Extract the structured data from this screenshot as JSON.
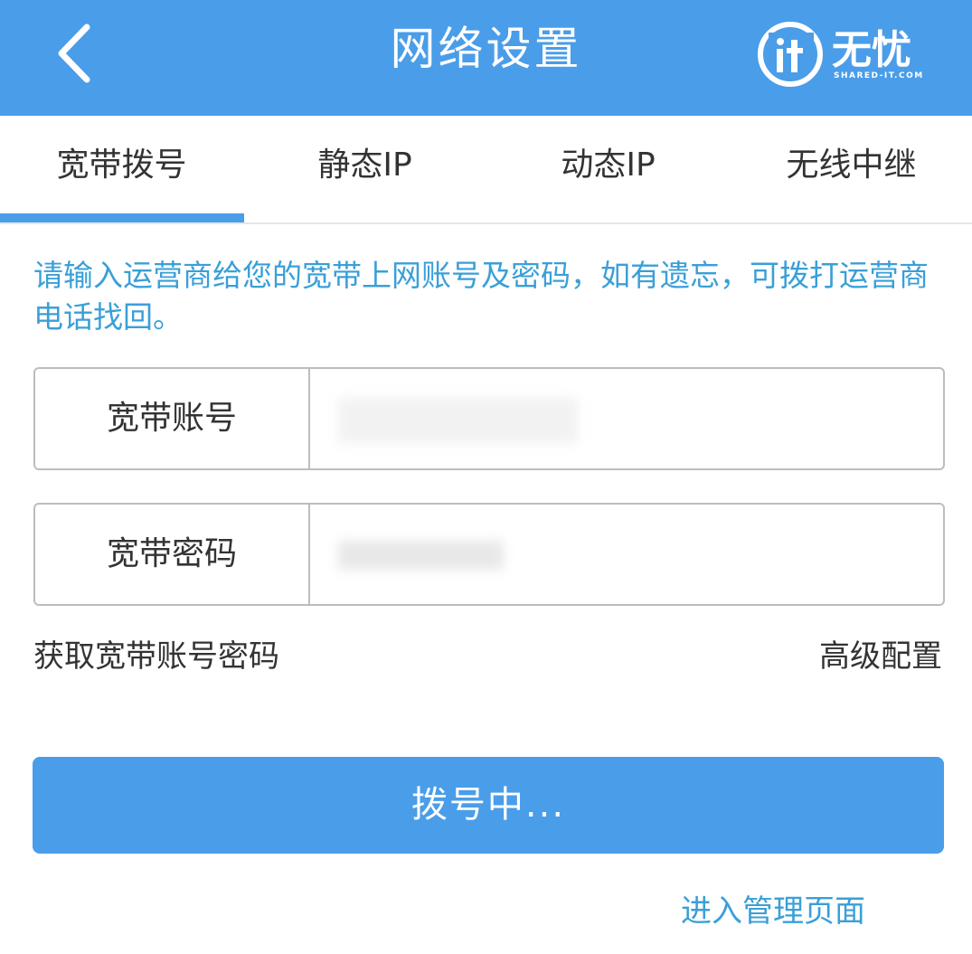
{
  "header": {
    "title": "网络设置",
    "logo_text": "无忧",
    "logo_subtext": "SHARED-IT.COM",
    "accent_color": "#4a9de9"
  },
  "tabs": [
    {
      "label": "宽带拨号",
      "active": true
    },
    {
      "label": "静态IP",
      "active": false
    },
    {
      "label": "动态IP",
      "active": false
    },
    {
      "label": "无线中继",
      "active": false
    }
  ],
  "hint": "请输入运营商给您的宽带上网账号及密码，如有遗忘，可拨打运营商电话找回。",
  "form": {
    "account_label": "宽带账号",
    "account_value": "",
    "password_label": "宽带密码",
    "password_value": ""
  },
  "links": {
    "get_account": "获取宽带账号密码",
    "advanced": "高级配置",
    "admin_page": "进入管理页面"
  },
  "dial_button": "拨号中..."
}
